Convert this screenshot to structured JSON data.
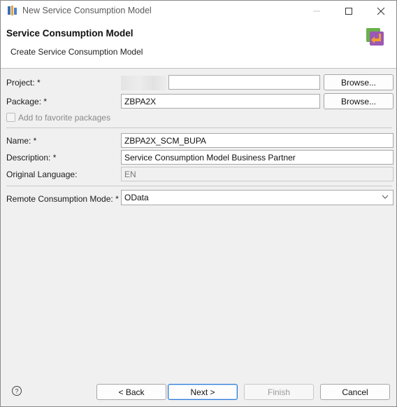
{
  "window": {
    "title": "New Service Consumption Model"
  },
  "header": {
    "title": "Service Consumption Model",
    "subtitle": "Create Service Consumption Model"
  },
  "form": {
    "project": {
      "label": "Project: *",
      "value": "",
      "button": "Browse..."
    },
    "package": {
      "label": "Package: *",
      "value": "ZBPA2X",
      "button": "Browse..."
    },
    "favorite": {
      "label": "Add to favorite packages",
      "checked": false
    },
    "name": {
      "label": "Name: *",
      "value": "ZBPA2X_SCM_BUPA"
    },
    "description": {
      "label": "Description: *",
      "value": "Service Consumption Model Business Partner"
    },
    "language": {
      "label": "Original Language:",
      "value": "EN"
    },
    "remote_mode": {
      "label": "Remote Consumption Mode: *",
      "value": "OData"
    }
  },
  "footer": {
    "back": "< Back",
    "next": "Next >",
    "finish": "Finish",
    "cancel": "Cancel"
  },
  "icons": {
    "app": "eclipse-app-icon",
    "wizard": "service-consumption-model-icon",
    "help": "help-icon"
  },
  "colors": {
    "accent": "#2a78d6",
    "wizard_icon_green": "#6ab04c",
    "wizard_icon_purple": "#9b59b6",
    "wizard_icon_orange": "#f0a030"
  }
}
